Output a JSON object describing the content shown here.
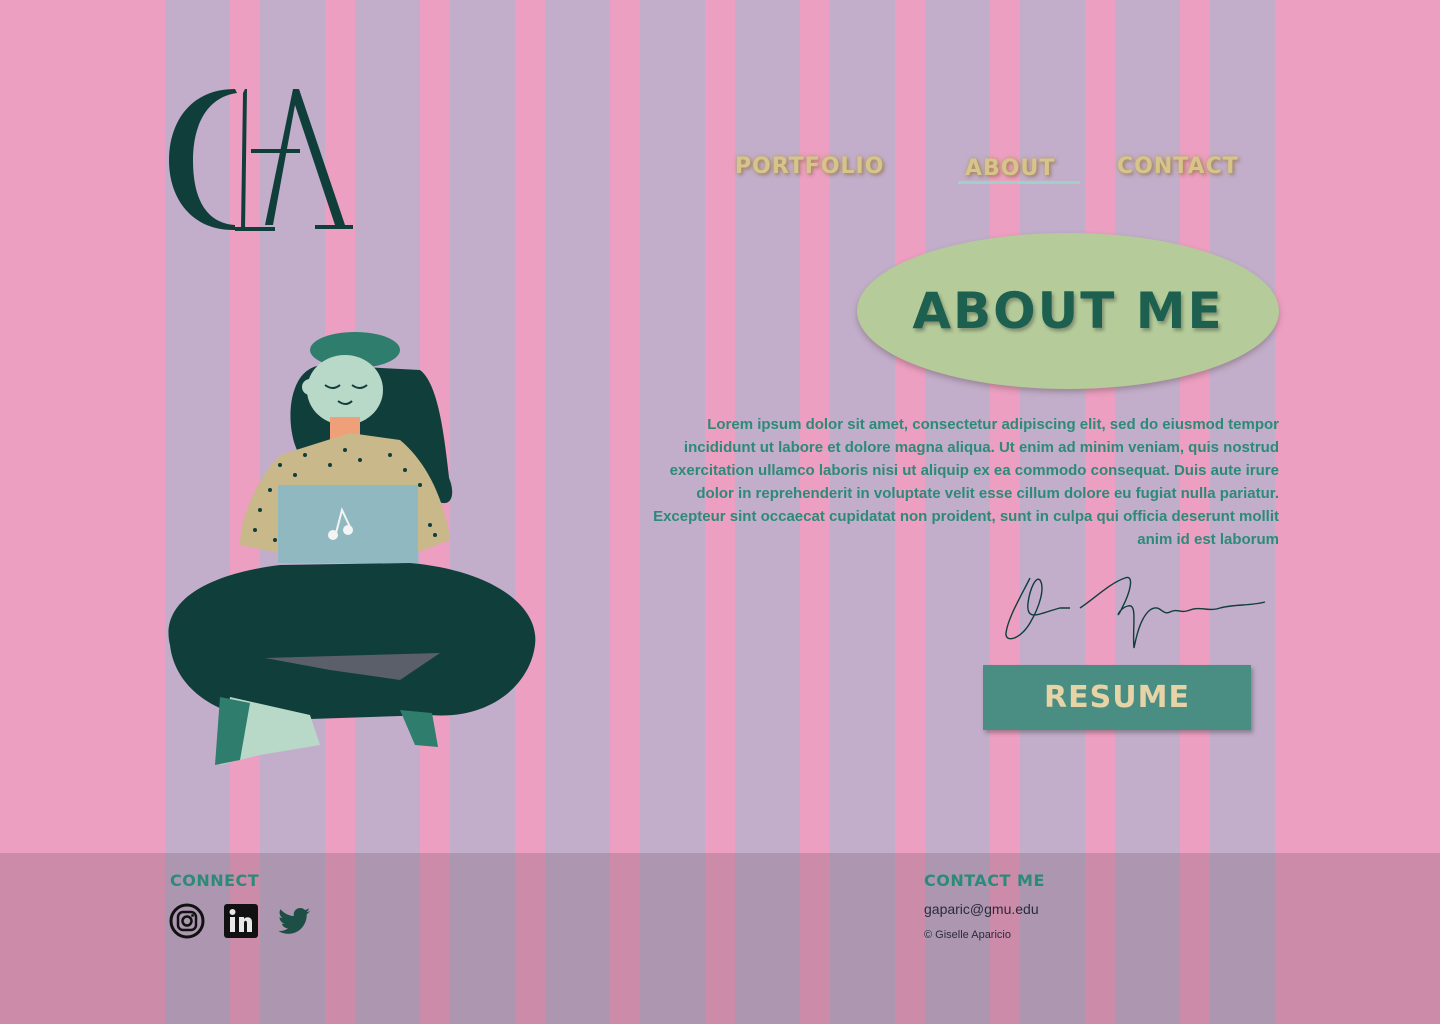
{
  "brand": {
    "logo_text": "GA"
  },
  "nav": {
    "items": [
      {
        "label": "PORTFOLIO"
      },
      {
        "label": "ABOUT"
      },
      {
        "label": "CONTACT"
      }
    ],
    "active": "ABOUT"
  },
  "about": {
    "title": "ABOUT ME",
    "body": "Lorem ipsum dolor sit amet, consectetur adipiscing elit, sed do eiusmod tempor incididunt ut labore et dolore magna aliqua. Ut enim ad minim veniam, quis nostrud exercitation ullamco laboris nisi ut aliquip ex ea commodo consequat. Duis aute irure dolor in reprehenderit in voluptate velit esse cillum dolore eu fugiat nulla pariatur. Excepteur sint occaecat cupidatat non proident, sunt in culpa qui officia deserunt mollit anim id est laborum",
    "resume_label": "RESUME"
  },
  "footer": {
    "connect_heading": "CONNECT",
    "social_icons": [
      "instagram-icon",
      "linkedin-icon",
      "twitter-icon"
    ],
    "contact_heading": "CONTACT ME",
    "email": "gaparic@gmu.edu",
    "copyright": "© Giselle Aparicio"
  },
  "colors": {
    "background": "#ec9fc0",
    "accent_teal": "#2c8a78",
    "dark_teal": "#0f3e3b",
    "oval": "#b5cc9a",
    "button": "#4a8e83",
    "nav_text": "#d7c48a"
  }
}
